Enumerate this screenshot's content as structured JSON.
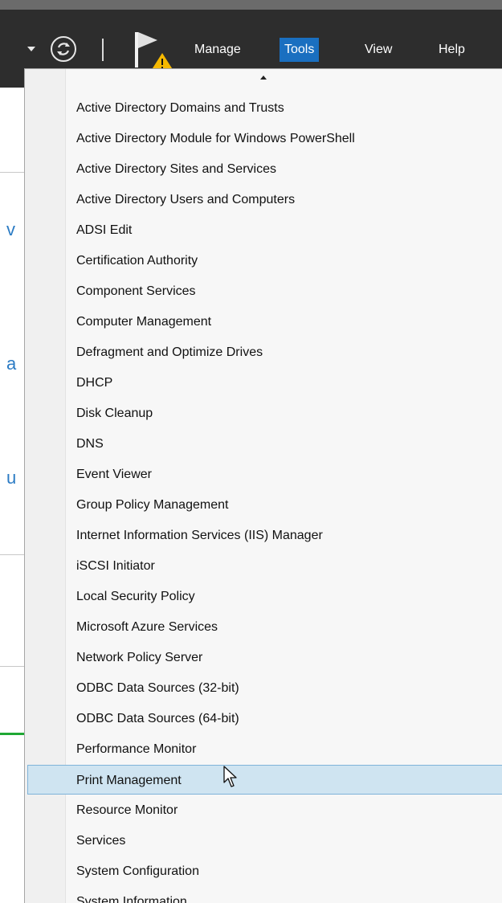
{
  "toolbar": {
    "menus": [
      {
        "label": "Manage",
        "active": false
      },
      {
        "label": "Tools",
        "active": true
      },
      {
        "label": "View",
        "active": false
      },
      {
        "label": "Help",
        "active": false
      }
    ],
    "accent_color": "#1a6fc0"
  },
  "background": {
    "fragments": [
      "v",
      "a",
      "u"
    ]
  },
  "tools_menu": {
    "items": [
      "Active Directory Domains and Trusts",
      "Active Directory Module for Windows PowerShell",
      "Active Directory Sites and Services",
      "Active Directory Users and Computers",
      "ADSI Edit",
      "Certification Authority",
      "Component Services",
      "Computer Management",
      "Defragment and Optimize Drives",
      "DHCP",
      "Disk Cleanup",
      "DNS",
      "Event Viewer",
      "Group Policy Management",
      "Internet Information Services (IIS) Manager",
      "iSCSI Initiator",
      "Local Security Policy",
      "Microsoft Azure Services",
      "Network Policy Server",
      "ODBC Data Sources (32-bit)",
      "ODBC Data Sources (64-bit)",
      "Performance Monitor",
      "Print Management",
      "Resource Monitor",
      "Services",
      "System Configuration",
      "System Information"
    ],
    "highlighted": "Print Management",
    "highlight_color": "#cfe4f1"
  }
}
